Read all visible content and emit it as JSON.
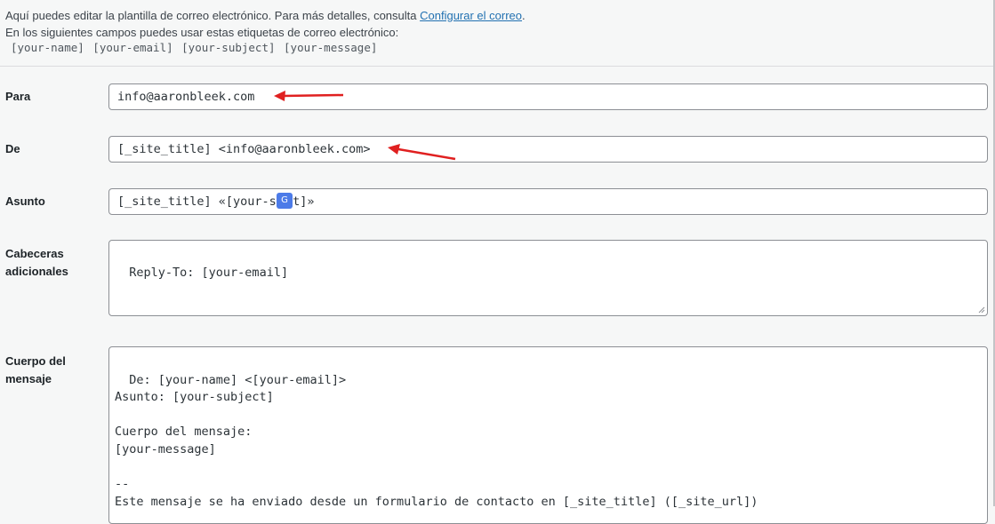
{
  "intro": {
    "line1_prefix": "Aquí puedes editar la plantilla de correo electrónico. Para más detalles, consulta",
    "line1_link": "Configurar el correo",
    "line1_suffix": ".",
    "line2": "En los siguientes campos puedes usar estas etiquetas de correo electrónico:",
    "tags": "[your-name] [your-email] [your-subject] [your-message]"
  },
  "fields": {
    "to": {
      "label": "Para",
      "value": "info@aaronbleek.com"
    },
    "from": {
      "label": "De",
      "value": "[_site_title] <info@aaronbleek.com>"
    },
    "subject": {
      "label": "Asunto",
      "value_prefix": "[_site_title] «[your-su",
      "value_suffix": "ct]»"
    },
    "headers": {
      "label_line1": "Cabeceras",
      "label_line2": "adicionales",
      "value": "Reply-To: [your-email]"
    },
    "body": {
      "label_line1": "Cuerpo del",
      "label_line2": "mensaje",
      "value": "De: [your-name] <[your-email]>\nAsunto: [your-subject]\n\nCuerpo del mensaje:\n[your-message]\n\n--\nEste mensaje se ha enviado desde un formulario de contacto en [_site_title] ([_site_url])"
    }
  },
  "colors": {
    "accent": "#2271b1",
    "annotation_arrow": "#e02020",
    "background": "#f6f7f7"
  },
  "icons": {
    "translate": "google-translate-icon",
    "arrow": "red-annotation-arrow"
  }
}
